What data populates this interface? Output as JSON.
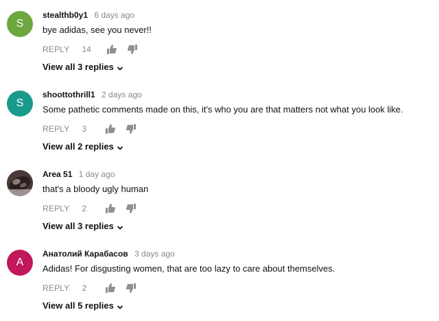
{
  "comments": [
    {
      "author": "stealthb0y1",
      "time": "6 days ago",
      "text": "bye adidas, see you never!!",
      "reply_label": "REPLY",
      "likes": "14",
      "view_replies": "View all 3 replies",
      "avatar_letter": "S",
      "avatar_color": "#6ea63f"
    },
    {
      "author": "shoottothrill1",
      "time": "2 days ago",
      "text": "Some pathetic comments made on this, it's who you are that matters not what you look like.",
      "reply_label": "REPLY",
      "likes": "3",
      "view_replies": "View all 2 replies",
      "avatar_letter": "S",
      "avatar_color": "#1a9a8a"
    },
    {
      "author": "Area 51",
      "time": "1 day ago",
      "text": "that's a bloody ugly human",
      "reply_label": "REPLY",
      "likes": "2",
      "view_replies": "View all 3 replies",
      "avatar_letter": "",
      "avatar_color": "#3a2a2a"
    },
    {
      "author": "Анатолий Карабасов",
      "time": "3 days ago",
      "text": "Adidas! For disgusting women, that are too lazy to care about themselves.",
      "reply_label": "REPLY",
      "likes": "2",
      "view_replies": "View all 5 replies",
      "avatar_letter": "А",
      "avatar_color": "#c2185b"
    }
  ],
  "icons": {
    "like": "thumbs-up-icon",
    "dislike": "thumbs-down-icon",
    "expand": "chevron-down-icon"
  },
  "colors": {
    "text_primary": "#111111",
    "text_secondary": "#888888"
  }
}
